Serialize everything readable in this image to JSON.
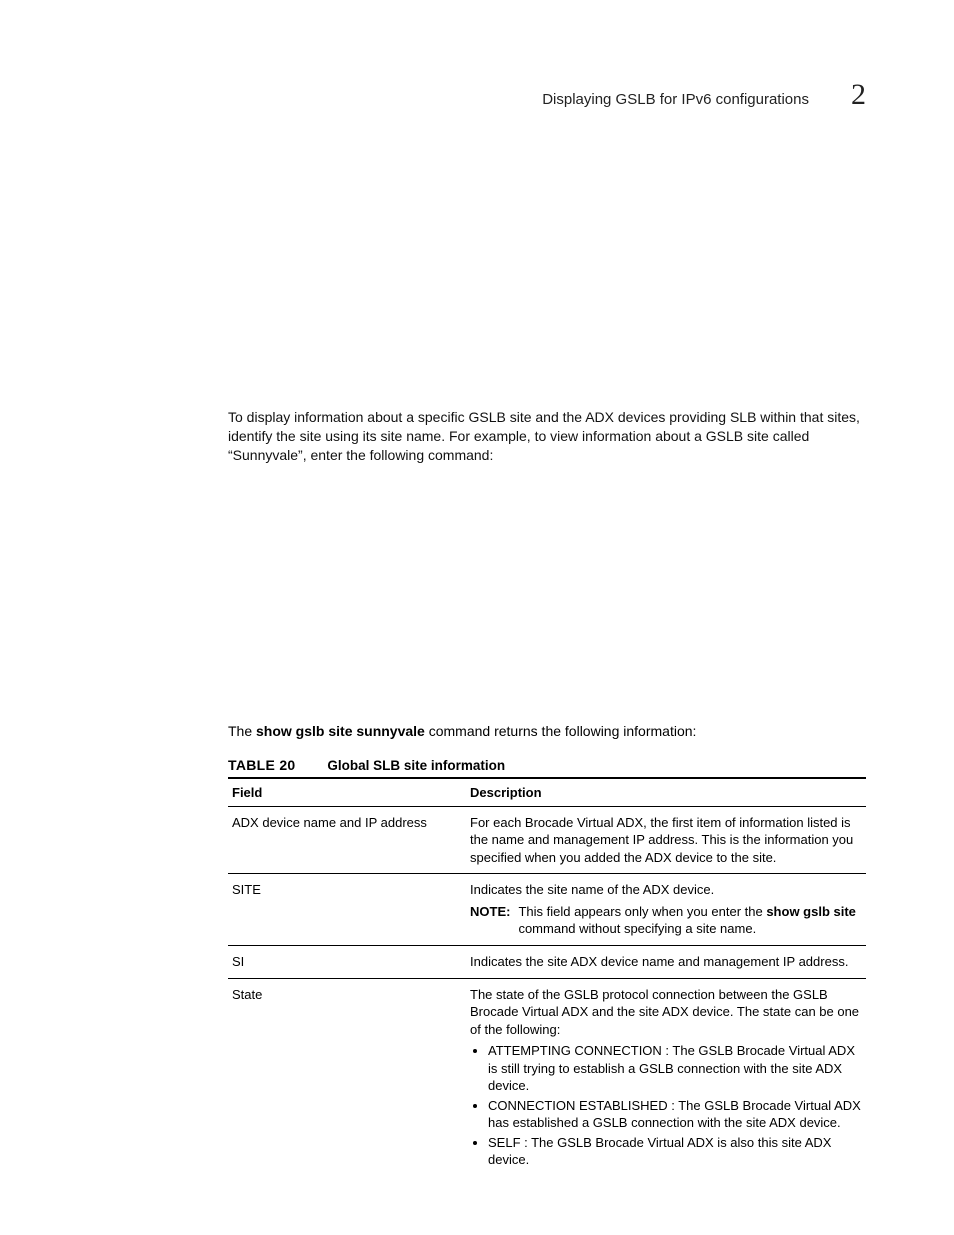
{
  "header": {
    "section_title": "Displaying GSLB for IPv6 configurations",
    "chapter_number": "2"
  },
  "intro_paragraph": "To display information about a specific GSLB site and the ADX devices providing SLB within that sites, identify the site using its site name. For example, to view information about a GSLB site called “Sunnyvale”, enter the following command:",
  "returns_line": {
    "pre": "The ",
    "cmd": "show gslb site sunnyvale",
    "post": " command returns the following information:"
  },
  "table": {
    "label": "TABLE 20",
    "title": "Global SLB site information",
    "head_field": "Field",
    "head_desc": "Description",
    "rows": {
      "r0": {
        "field": "ADX device name and IP address",
        "desc": "For each Brocade Virtual ADX, the first item of information listed is the name and management IP address. This is the information you specified when you added the ADX device to the site."
      },
      "r1": {
        "field": "SITE",
        "desc": "Indicates the site name of the ADX device.",
        "note_label": "NOTE:",
        "note_pre": "This field appears only when you enter the ",
        "note_cmd": "show gslb site",
        "note_post": " command without specifying a site name."
      },
      "r2": {
        "field": "SI",
        "desc": "Indicates the site ADX device name and management IP address."
      },
      "r3": {
        "field": "State",
        "desc": "The state of the GSLB protocol connection between the GSLB Brocade Virtual ADX and the site ADX device. The state can be one of the following:",
        "b0": "ATTEMPTING CONNECTION : The GSLB Brocade Virtual ADX is still trying to establish a GSLB connection with the site ADX device.",
        "b1": "CONNECTION ESTABLISHED : The GSLB Brocade Virtual ADX has established a GSLB connection with the site ADX device.",
        "b2": "SELF : The GSLB Brocade Virtual ADX is also this site ADX device."
      }
    }
  }
}
